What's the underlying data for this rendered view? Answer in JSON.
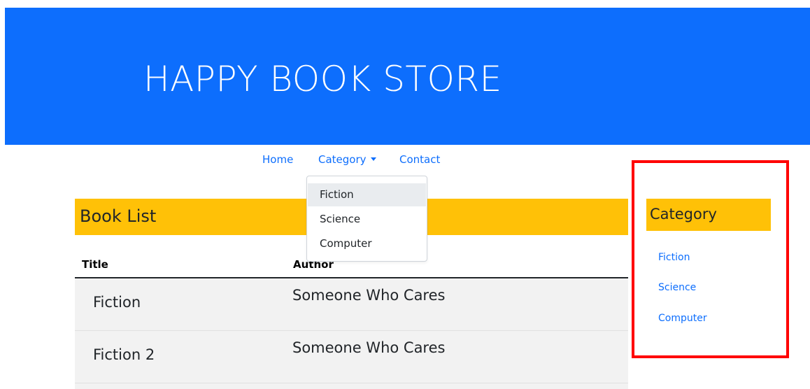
{
  "header": {
    "title": "HAPPY BOOK STORE",
    "background": "#0d6efd"
  },
  "nav": {
    "home": "Home",
    "category": "Category",
    "contact": "Contact"
  },
  "category_dropdown": {
    "items": [
      "Fiction",
      "Science",
      "Computer"
    ],
    "hovered": "Fiction"
  },
  "book_list": {
    "heading": "Book List",
    "columns": [
      "Title",
      "Author"
    ],
    "rows": [
      {
        "title": "Fiction",
        "author": "Someone Who Cares"
      },
      {
        "title": "Fiction 2",
        "author": "Someone Who Cares"
      }
    ]
  },
  "sidebar": {
    "heading": "Category",
    "links": [
      "Fiction",
      "Science",
      "Computer"
    ]
  },
  "colors": {
    "primary": "#0d6efd",
    "heading_bg": "#ffc107",
    "highlight_border": "#ff0000",
    "row_bg": "#f2f2f2"
  }
}
